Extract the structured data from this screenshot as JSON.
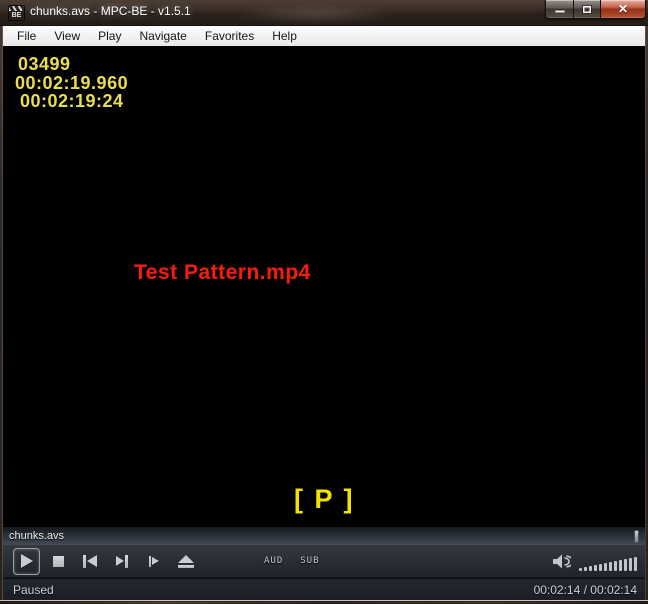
{
  "window": {
    "title": "chunks.avs - MPC-BE - v1.5.1",
    "app_icon": "mpc-be-clapperboard-icon",
    "app_icon_text": "BE"
  },
  "menu": {
    "items": [
      "File",
      "View",
      "Play",
      "Navigate",
      "Favorites",
      "Help"
    ]
  },
  "osd": {
    "frame_number": "03499",
    "time": "00:02:19.960",
    "timecode": "00:02:19:24",
    "media_title": "Test Pattern.mp4",
    "state_indicator": "[ P ]",
    "colors": {
      "osd_yellow": "#e9dd52",
      "state_yellow": "#f2e400",
      "title_red": "#e8220e"
    }
  },
  "seekbar": {
    "label": "chunks.avs",
    "position_percent": 100
  },
  "controls": {
    "buttons": [
      "play",
      "stop",
      "skip-back",
      "skip-forward",
      "frame-step",
      "eject"
    ],
    "active_button": "play",
    "aud_label": "AUD",
    "sub_label": "SUB",
    "volume": {
      "segments": 12,
      "level_percent": 100
    }
  },
  "statusbar": {
    "state": "Paused",
    "time_display": "00:02:14 / 00:02:14"
  }
}
